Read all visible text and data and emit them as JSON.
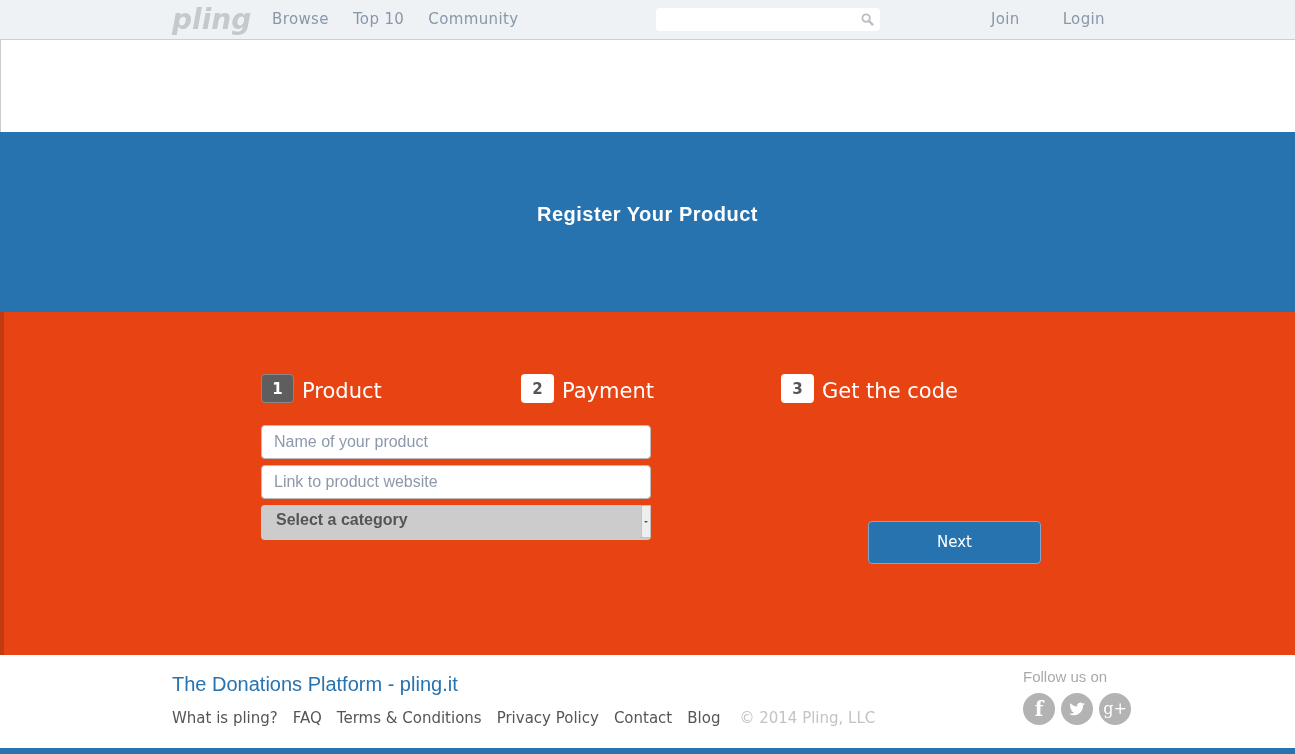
{
  "nav": {
    "logo": "pling",
    "links": [
      "Browse",
      "Top 10",
      "Community"
    ],
    "account": [
      "Join",
      "Login"
    ]
  },
  "banner": {
    "title": "Register Your Product"
  },
  "steps": [
    {
      "number": "1",
      "label": "Product",
      "selected": true
    },
    {
      "number": "2",
      "label": "Payment",
      "selected": false
    },
    {
      "number": "3",
      "label": "Get the code",
      "selected": false
    }
  ],
  "form": {
    "fields": [
      {
        "placeholder": "Name of your product"
      },
      {
        "placeholder": "Link to product website"
      }
    ],
    "category": {
      "value": "Select a category"
    },
    "next": "Next"
  },
  "footer": {
    "title": "The Donations Platform - pling.it",
    "links": [
      "What is pling?",
      "FAQ",
      "Terms & Conditions",
      "Privacy Policy",
      "Contact",
      "Blog"
    ],
    "copyright": "© 2014 Pling, LLC",
    "follow": "Follow us on",
    "social": [
      {
        "kind": "facebook",
        "glyph": "f"
      },
      {
        "kind": "twitter"
      },
      {
        "kind": "googleplus",
        "glyph": "g+"
      }
    ]
  }
}
